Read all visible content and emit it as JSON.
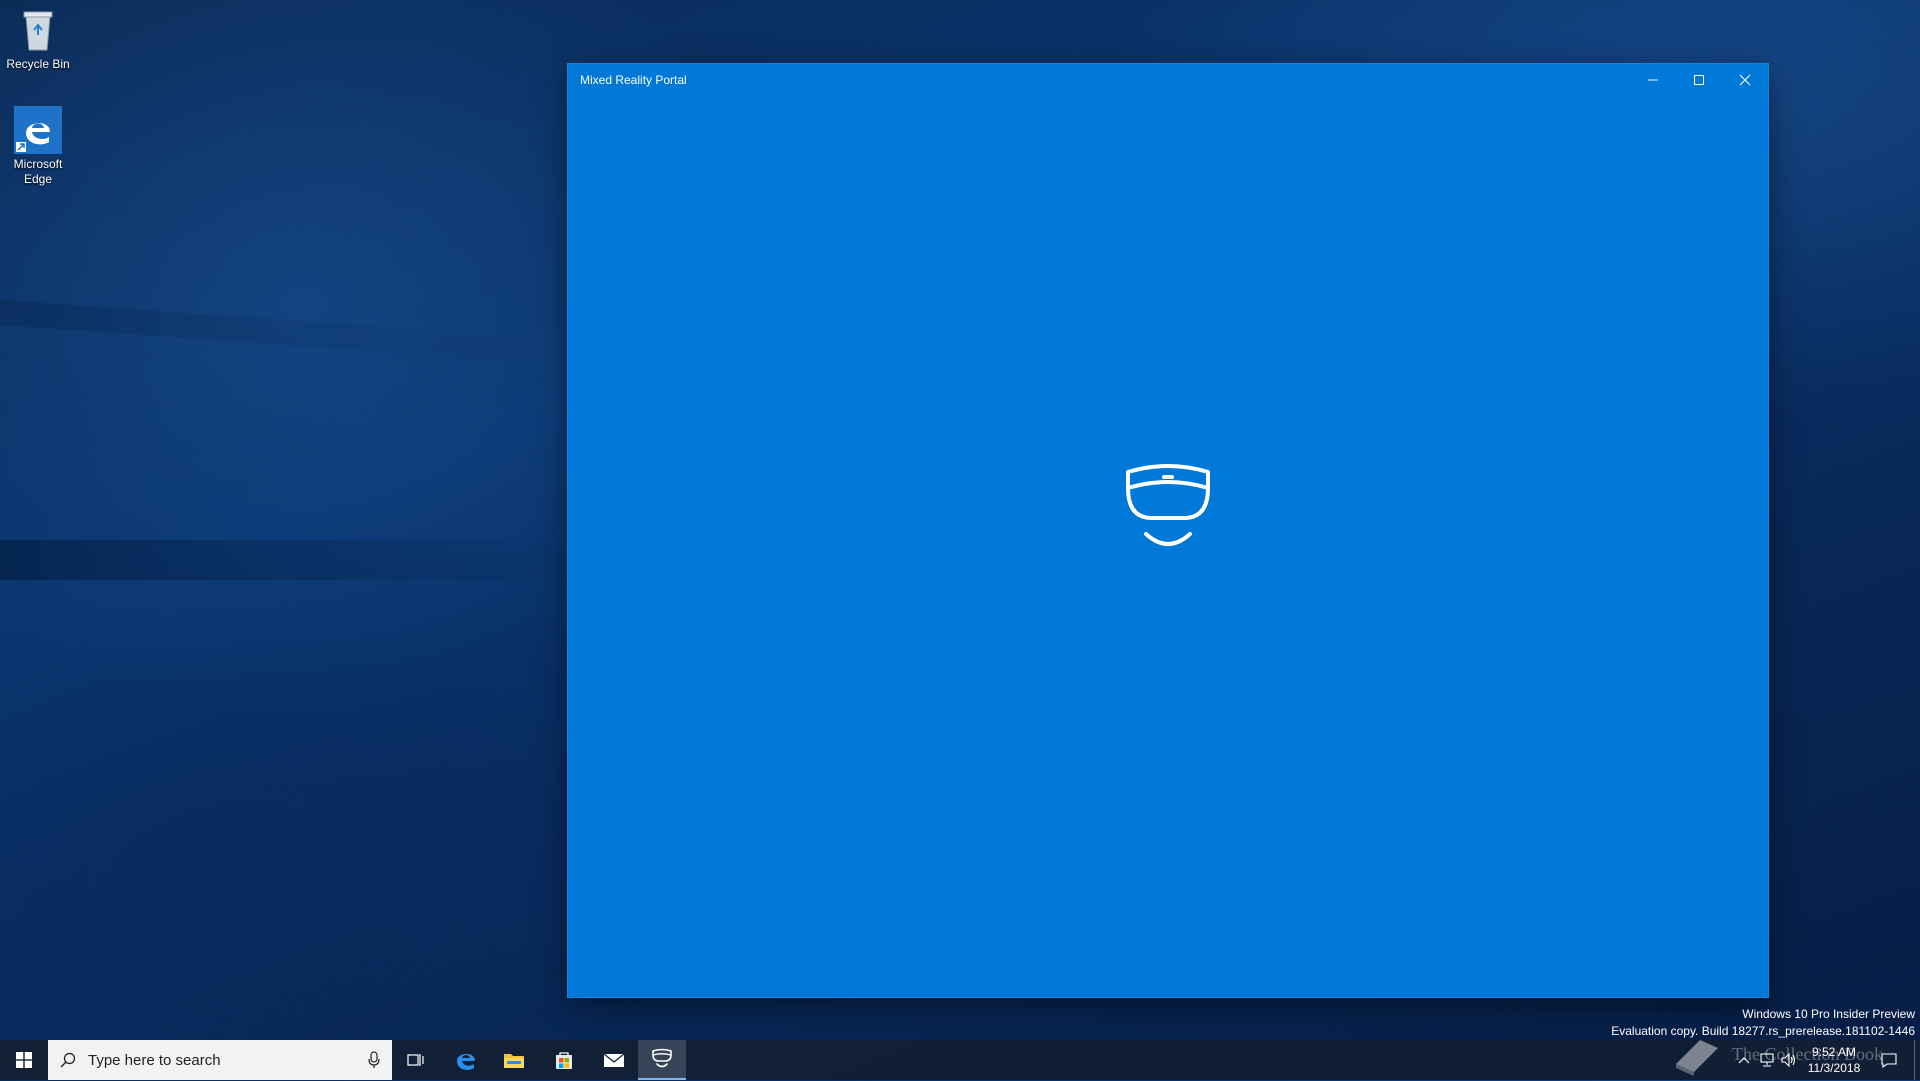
{
  "desktop": {
    "icons": [
      {
        "label": "Recycle Bin",
        "icon": "recycle-bin-icon"
      },
      {
        "label": "Microsoft Edge",
        "icon": "edge-icon"
      }
    ]
  },
  "window": {
    "title": "Mixed Reality Portal",
    "accent": "#0078d7",
    "controls": [
      "minimize-icon",
      "maximize-icon",
      "close-icon"
    ],
    "center_icon": "mixed-reality-headset-icon"
  },
  "watermark": {
    "line1": "Windows 10 Pro Insider Preview",
    "line2": "Evaluation copy. Build 18277.rs_prerelease.181102-1446"
  },
  "taskbar": {
    "search_placeholder": "Type here to search",
    "apps": [
      "task-view-icon",
      "edge-icon",
      "file-explorer-icon",
      "store-icon",
      "mail-icon",
      "mixed-reality-portal-icon"
    ],
    "clock_time": "9:52 AM",
    "clock_date": "11/3/2018",
    "overlay_text": "The Collection Book"
  }
}
